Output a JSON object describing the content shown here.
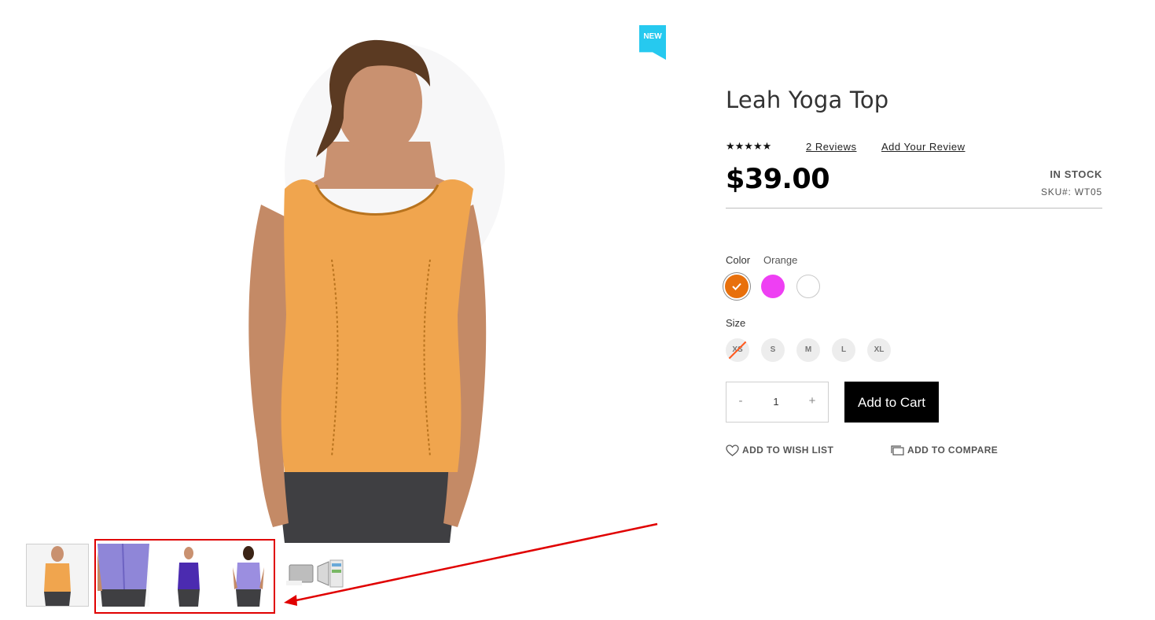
{
  "gallery": {
    "badge": "NEW",
    "thumbnail_count": 5
  },
  "product": {
    "title": "Leah Yoga Top",
    "rating_stars": "★★★★★",
    "reviews_link": "2 Reviews",
    "add_review_link": "Add Your Review",
    "price": "$39.00",
    "stock_status": "IN STOCK",
    "sku": "SKU#:  WT05"
  },
  "options": {
    "color_label": "Color",
    "color_selected": "Orange",
    "colors": [
      "#e8700c",
      "#ee3ff3",
      "#ffffff"
    ],
    "size_label": "Size",
    "sizes": [
      "XS",
      "S",
      "M",
      "L",
      "XL"
    ]
  },
  "cart": {
    "minus": "-",
    "quantity": "1",
    "plus": "+",
    "add_to_cart": "Add to Cart"
  },
  "actions": {
    "wishlist": "ADD TO WISH LIST",
    "compare": "ADD TO COMPARE"
  },
  "annotation_color": "#e00000"
}
